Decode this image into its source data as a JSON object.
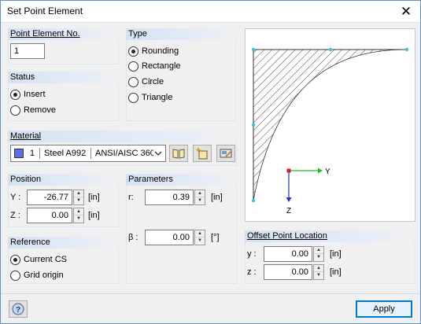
{
  "window": {
    "title": "Set Point Element",
    "close_glyph": "✕"
  },
  "point_element": {
    "header": "Point Element No.",
    "number": "1"
  },
  "type": {
    "header": "Type",
    "options": [
      {
        "label": "Rounding",
        "selected": true
      },
      {
        "label": "Rectangle",
        "selected": false
      },
      {
        "label": "Circle",
        "selected": false
      },
      {
        "label": "Triangle",
        "selected": false
      }
    ]
  },
  "status": {
    "header": "Status",
    "options": [
      {
        "label": "Insert",
        "selected": true
      },
      {
        "label": "Remove",
        "selected": false
      }
    ]
  },
  "material": {
    "header": "Material",
    "color": "#5c6ee8",
    "number": "1",
    "name": "Steel A992",
    "standard": "ANSI/AISC 360"
  },
  "position": {
    "header": "Position",
    "y_label": "Y :",
    "y_value": "-26.77",
    "y_unit": "[in]",
    "z_label": "Z :",
    "z_value": "0.00",
    "z_unit": "[in]"
  },
  "parameters": {
    "header": "Parameters",
    "r_label": "r:",
    "r_value": "0.39",
    "r_unit": "[in]",
    "beta_label": "β :",
    "beta_value": "0.00",
    "beta_unit": "[°]"
  },
  "reference": {
    "header": "Reference",
    "options": [
      {
        "label": "Current CS",
        "selected": true
      },
      {
        "label": "Grid origin",
        "selected": false
      }
    ]
  },
  "offset": {
    "header": "Offset Point Location",
    "y_label": "y :",
    "y_value": "0.00",
    "y_unit": "[in]",
    "z_label": "z :",
    "z_value": "0.00",
    "z_unit": "[in]"
  },
  "preview": {
    "axis_y_label": "Y",
    "axis_z_label": "Z",
    "axis_y_color": "#22bb22",
    "axis_z_color": "#2233cc"
  },
  "footer": {
    "apply_label": "Apply"
  },
  "icons": [
    "close-icon",
    "library-icon",
    "new-material-icon",
    "edit-material-icon",
    "help-icon",
    "chevron-down-icon",
    "spin-up-icon",
    "spin-down-icon"
  ]
}
